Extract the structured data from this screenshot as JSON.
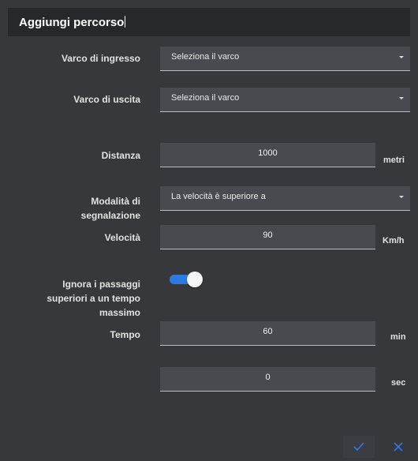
{
  "dialog": {
    "title": "Aggiungi percorso",
    "entry_gate": {
      "label": "Varco di ingresso",
      "value": "Seleziona il varco"
    },
    "exit_gate": {
      "label": "Varco di uscita",
      "value": "Seleziona il varco"
    },
    "distance": {
      "label": "Distanza",
      "value": "1000",
      "unit": "metri"
    },
    "mode": {
      "label_line1": "Modalità di",
      "label_line2": "segnalazione",
      "value": "La velocità è superiore a"
    },
    "speed": {
      "label": "Velocità",
      "value": "90",
      "unit": "Km/h"
    },
    "ignore_toggle": {
      "label_line1": "Ignora i passaggi",
      "label_line2": "superiori a un tempo",
      "label_line3": "massimo",
      "on": true
    },
    "time": {
      "label": "Tempo",
      "minutes": "60",
      "minutes_unit": "min",
      "seconds": "0",
      "seconds_unit": "sec"
    },
    "colors": {
      "accent": "#2c7be5",
      "background": "#37383c",
      "titlebar": "#27282b"
    }
  }
}
